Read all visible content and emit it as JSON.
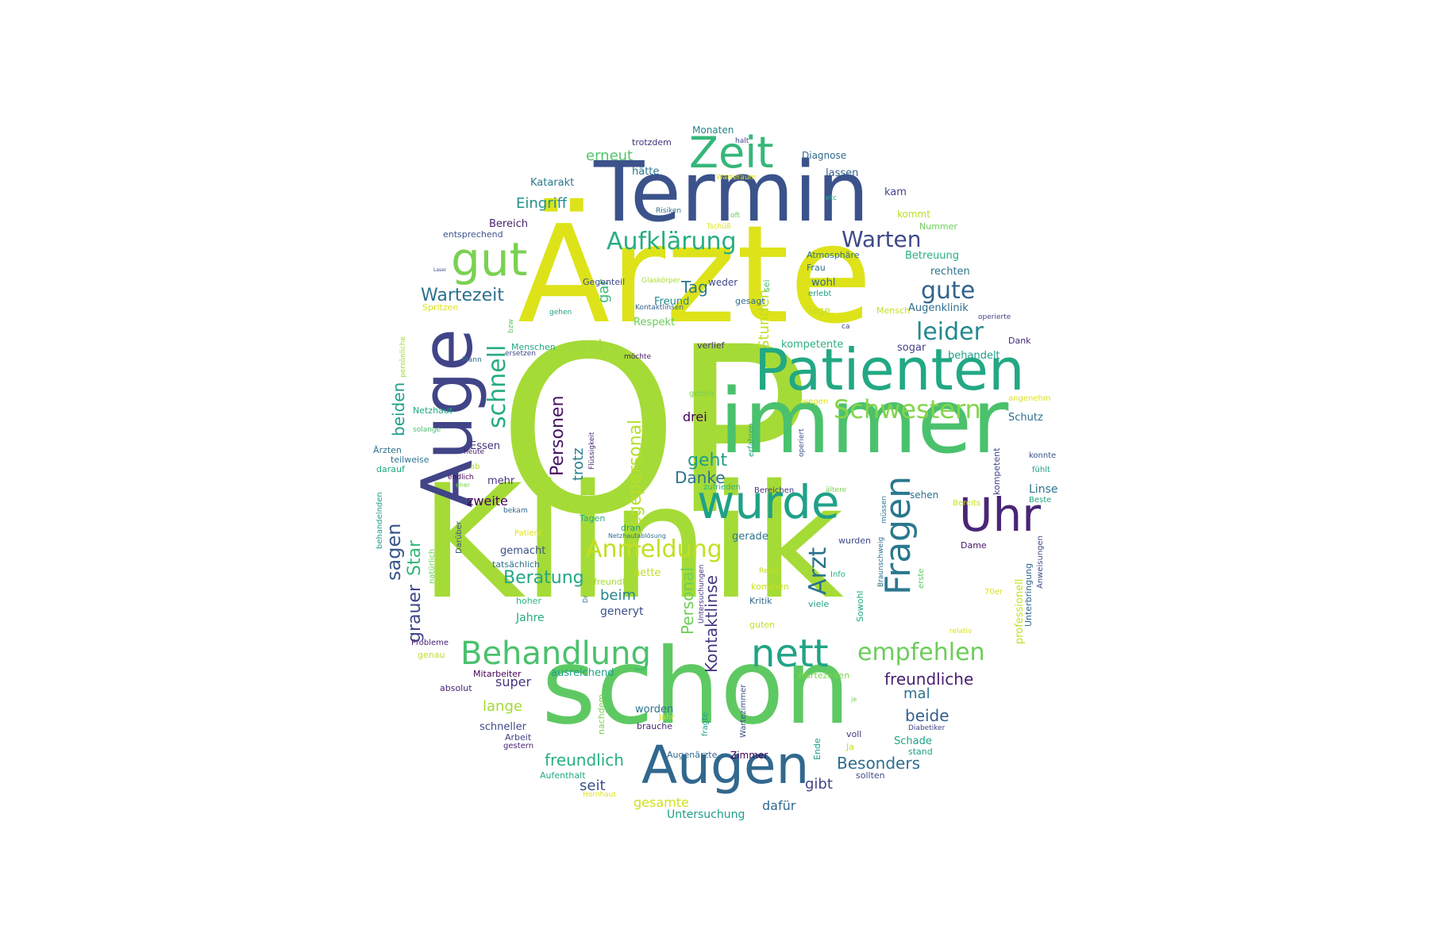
{
  "words": [
    {
      "text": "OP",
      "color": "#a5db36"
    },
    {
      "text": "Klinik",
      "color": "#a5db36"
    },
    {
      "text": "Ärzte",
      "color": "#dde318"
    },
    {
      "text": "immer",
      "color": "#4ac16d"
    },
    {
      "text": "schon",
      "color": "#5ec962"
    },
    {
      "text": "Termin",
      "color": "#3b528b"
    },
    {
      "text": "Auge",
      "color": "#414487"
    },
    {
      "text": "Patienten",
      "color": "#22a884"
    },
    {
      "text": "Augen",
      "color": "#31688e"
    },
    {
      "text": "wurde",
      "color": "#1fa187"
    },
    {
      "text": "Zeit",
      "color": "#35b779"
    },
    {
      "text": "Uhr",
      "color": "#482677"
    },
    {
      "text": "gut",
      "color": "#7ad151"
    },
    {
      "text": "nett",
      "color": "#20a486"
    },
    {
      "text": "Behandlung",
      "color": "#4ac16d"
    },
    {
      "text": "Fragen",
      "color": "#2a788e"
    },
    {
      "text": "Arzt",
      "color": "#2c728e"
    },
    {
      "text": "empfehlen",
      "color": "#6ccd5a"
    },
    {
      "text": "Schwestern",
      "color": "#84d44b"
    },
    {
      "text": "Aufklärung",
      "color": "#27ad81"
    },
    {
      "text": "Warten",
      "color": "#3e4a89"
    },
    {
      "text": "leider",
      "color": "#23898e"
    },
    {
      "text": "gute",
      "color": "#33638d"
    },
    {
      "text": "schnell",
      "color": "#25ab82"
    },
    {
      "text": "Wartezeit",
      "color": "#2d708e"
    },
    {
      "text": "Personen",
      "color": "#471365"
    },
    {
      "text": "Pflegepersonal",
      "color": "#b5de2b"
    },
    {
      "text": "Kontaktlinse",
      "color": "#453781"
    },
    {
      "text": "Personal",
      "color": "#6ece58"
    },
    {
      "text": "sagen",
      "color": "#39568c"
    },
    {
      "text": "grauer",
      "color": "#3f4788"
    },
    {
      "text": "Star",
      "color": "#35b779"
    },
    {
      "text": "beiden",
      "color": "#1f9e89"
    },
    {
      "text": "trotz",
      "color": "#26828e"
    },
    {
      "text": "Stunden",
      "color": "#c0df25"
    },
    {
      "text": "gar",
      "color": "#3aba76"
    },
    {
      "text": "geht",
      "color": "#1e9c89"
    },
    {
      "text": "Danke",
      "color": "#2c738e"
    },
    {
      "text": "Anmeldung",
      "color": "#c2df23"
    },
    {
      "text": "Beratung",
      "color": "#22a785"
    },
    {
      "text": "beide",
      "color": "#34618d"
    },
    {
      "text": "freundliche",
      "color": "#481f70"
    },
    {
      "text": "freundlich",
      "color": "#29af7f"
    },
    {
      "text": "Besonders",
      "color": "#2e6e8e"
    },
    {
      "text": "zwei",
      "color": "#9bd93c"
    },
    {
      "text": "erneut",
      "color": "#52c569"
    },
    {
      "text": "Eingriff",
      "color": "#21918c"
    },
    {
      "text": "Tag",
      "color": "#2a788e"
    },
    {
      "text": "mal",
      "color": "#2c738e"
    },
    {
      "text": "beim",
      "color": "#24868e"
    },
    {
      "text": "lange",
      "color": "#a2da37"
    },
    {
      "text": "super",
      "color": "#46337e"
    },
    {
      "text": "seit",
      "color": "#3b528b"
    },
    {
      "text": "gibt",
      "color": "#414487"
    },
    {
      "text": "zweite",
      "color": "#440154"
    },
    {
      "text": "drei",
      "color": "#440154"
    },
    {
      "text": "dafür",
      "color": "#30698e"
    },
    {
      "text": "gesamte",
      "color": "#d0e11c"
    },
    {
      "text": "Untersuchung",
      "color": "#1f9e89"
    },
    {
      "text": "Katarakt",
      "color": "#2a788e"
    },
    {
      "text": "hätte",
      "color": "#2a788e"
    },
    {
      "text": "lassen",
      "color": "#34618d"
    },
    {
      "text": "Diagnose",
      "color": "#31688e"
    },
    {
      "text": "Monaten",
      "color": "#25848e"
    },
    {
      "text": "trotzdem",
      "color": "#46337e"
    },
    {
      "text": "halt",
      "color": "#404588"
    },
    {
      "text": "Warteraum",
      "color": "#dde318"
    },
    {
      "text": "kam",
      "color": "#414487"
    },
    {
      "text": "etc",
      "color": "#25ab82"
    },
    {
      "text": "kommt",
      "color": "#b8de29"
    },
    {
      "text": "Nummer",
      "color": "#6ccd5a"
    },
    {
      "text": "Risiken",
      "color": "#2c738e"
    },
    {
      "text": "Tschüß",
      "color": "#dde318"
    },
    {
      "text": "oft",
      "color": "#6ece58"
    },
    {
      "text": "Bereich",
      "color": "#481f70"
    },
    {
      "text": "entsprechend",
      "color": "#3b528b"
    },
    {
      "text": "Gegenteil",
      "color": "#3e4a89"
    },
    {
      "text": "Glaskörper",
      "color": "#a8db34"
    },
    {
      "text": "weder",
      "color": "#3f4788"
    },
    {
      "text": "Frau",
      "color": "#2e6e8e"
    },
    {
      "text": "Atmosphäre",
      "color": "#2c728e"
    },
    {
      "text": "Betreuung",
      "color": "#29af7f"
    },
    {
      "text": "rechten",
      "color": "#2c728e"
    },
    {
      "text": "Laser",
      "color": "#3e4a89"
    },
    {
      "text": "Freund",
      "color": "#238a8d"
    },
    {
      "text": "gesagt",
      "color": "#2e6e8e"
    },
    {
      "text": "wohl",
      "color": "#31688e"
    },
    {
      "text": "erlebt",
      "color": "#1fa088"
    },
    {
      "text": "Augenklinik",
      "color": "#2e6e8e"
    },
    {
      "text": "Kontaktlinsen",
      "color": "#34618d"
    },
    {
      "text": "Spritzen",
      "color": "#dde318"
    },
    {
      "text": "gehen",
      "color": "#1fa187"
    },
    {
      "text": "sei",
      "color": "#4ac16d"
    },
    {
      "text": "Tage",
      "color": "#c2df23"
    },
    {
      "text": "Mensch",
      "color": "#c2df23"
    },
    {
      "text": "operierte",
      "color": "#414487"
    },
    {
      "text": "bzw",
      "color": "#5ec962"
    },
    {
      "text": "Respekt",
      "color": "#6ccd5a"
    },
    {
      "text": "ca",
      "color": "#404588"
    },
    {
      "text": "Dank",
      "color": "#482677"
    },
    {
      "text": "persönliche",
      "color": "#9bd93c"
    },
    {
      "text": "Mann",
      "color": "#2e6e8e"
    },
    {
      "text": "Menschen",
      "color": "#22a785"
    },
    {
      "text": "verlief",
      "color": "#46337e"
    },
    {
      "text": "kompetente",
      "color": "#2db27d"
    },
    {
      "text": "sogar",
      "color": "#414487"
    },
    {
      "text": "ersetzen",
      "color": "#3e4a89"
    },
    {
      "text": "möchte",
      "color": "#481769"
    },
    {
      "text": "behandelt",
      "color": "#1fa188"
    },
    {
      "text": "angenehm",
      "color": "#dde318"
    },
    {
      "text": "Netzhaut",
      "color": "#22a884"
    },
    {
      "text": "geben",
      "color": "#7ad151"
    },
    {
      "text": "wegen",
      "color": "#dde318"
    },
    {
      "text": "Schutz",
      "color": "#2c728e"
    },
    {
      "text": "solange",
      "color": "#4ac16d"
    },
    {
      "text": "Essen",
      "color": "#46337e"
    },
    {
      "text": "Flüssigkeit",
      "color": "#482677"
    },
    {
      "text": "operiert",
      "color": "#3b528b"
    },
    {
      "text": "erfahren",
      "color": "#22a884"
    },
    {
      "text": "konnte",
      "color": "#3b528b"
    },
    {
      "text": "fühlt",
      "color": "#1f9e89"
    },
    {
      "text": "Ärzten",
      "color": "#2d708e"
    },
    {
      "text": "teilweise",
      "color": "#2c728e"
    },
    {
      "text": "heute",
      "color": "#481f70"
    },
    {
      "text": "darauf",
      "color": "#22a884"
    },
    {
      "text": "ab",
      "color": "#b8de29"
    },
    {
      "text": "endlich",
      "color": "#440154"
    },
    {
      "text": "eher",
      "color": "#7ad151"
    },
    {
      "text": "mehr",
      "color": "#46337e"
    },
    {
      "text": "kompetent",
      "color": "#3f4788"
    },
    {
      "text": "Linse",
      "color": "#2c738e"
    },
    {
      "text": "Beste",
      "color": "#20a386"
    },
    {
      "text": "Bereits",
      "color": "#c8e020"
    },
    {
      "text": "sehen",
      "color": "#2c728e"
    },
    {
      "text": "zufrieden",
      "color": "#2db27d"
    },
    {
      "text": "Bereichen",
      "color": "#453781"
    },
    {
      "text": "ältere",
      "color": "#7ad151"
    },
    {
      "text": "müssen",
      "color": "#2a788e"
    },
    {
      "text": "Braunschweig",
      "color": "#2d708e"
    },
    {
      "text": "wurden",
      "color": "#3e4a89"
    },
    {
      "text": "gerade",
      "color": "#2c728e"
    },
    {
      "text": "behandelnden",
      "color": "#1f9e89"
    },
    {
      "text": "bekam",
      "color": "#31688e"
    },
    {
      "text": "Tagen",
      "color": "#27ad81"
    },
    {
      "text": "Patient",
      "color": "#dde318"
    },
    {
      "text": "Darüber",
      "color": "#3b528b"
    },
    {
      "text": "dran",
      "color": "#1f9e89"
    },
    {
      "text": "Netzhautablösung",
      "color": "#2c728e"
    },
    {
      "text": "professionell",
      "color": "#c2df23"
    },
    {
      "text": "Unterbringung",
      "color": "#31688e"
    },
    {
      "text": "Anweisungen",
      "color": "#3e4a89"
    },
    {
      "text": "Dame",
      "color": "#471365"
    },
    {
      "text": "gemacht",
      "color": "#3b528b"
    },
    {
      "text": "tatsächlich",
      "color": "#2c728e"
    },
    {
      "text": "natürlich",
      "color": "#6ccd5a"
    },
    {
      "text": "nette",
      "color": "#c2df23"
    },
    {
      "text": "Untersuchungen",
      "color": "#46337e"
    },
    {
      "text": "unfreundlich",
      "color": "#a2da37"
    },
    {
      "text": "Regel",
      "color": "#c2df23"
    },
    {
      "text": "Info",
      "color": "#29af7f"
    },
    {
      "text": "kommen",
      "color": "#c8e020"
    },
    {
      "text": "erste",
      "color": "#5ec962"
    },
    {
      "text": "70er",
      "color": "#dde318"
    },
    {
      "text": "Dr",
      "color": "#2c728e"
    },
    {
      "text": "hoher",
      "color": "#2db27d"
    },
    {
      "text": "Kritik",
      "color": "#31688e"
    },
    {
      "text": "viele",
      "color": "#20a386"
    },
    {
      "text": "Sowohl",
      "color": "#22a884"
    },
    {
      "text": "Jahre",
      "color": "#25ab82"
    },
    {
      "text": "generyt",
      "color": "#3b528b"
    },
    {
      "text": "guten",
      "color": "#c2df23"
    },
    {
      "text": "relativ",
      "color": "#dde318"
    },
    {
      "text": "Probleme",
      "color": "#481f70"
    },
    {
      "text": "genau",
      "color": "#c2df23"
    },
    {
      "text": "Mitarbeiter",
      "color": "#440154"
    },
    {
      "text": "ausreichend",
      "color": "#1fa088"
    },
    {
      "text": "Wartezeiten",
      "color": "#7ad151"
    },
    {
      "text": "absolut",
      "color": "#482677"
    },
    {
      "text": "je",
      "color": "#6ece58"
    },
    {
      "text": "nachdem",
      "color": "#7ad151"
    },
    {
      "text": "worden",
      "color": "#2c728e"
    },
    {
      "text": "Jahr",
      "color": "#c2df23"
    },
    {
      "text": "brauche",
      "color": "#482677"
    },
    {
      "text": "fragte",
      "color": "#1fa188"
    },
    {
      "text": "Wartezimmer",
      "color": "#3b528b"
    },
    {
      "text": "schneller",
      "color": "#3e4a89"
    },
    {
      "text": "Arbeit",
      "color": "#404588"
    },
    {
      "text": "gestern",
      "color": "#481f70"
    },
    {
      "text": "Diabetiker",
      "color": "#404588"
    },
    {
      "text": "voll",
      "color": "#46337e"
    },
    {
      "text": "Ja",
      "color": "#c8e020"
    },
    {
      "text": "Ende",
      "color": "#1f9e89"
    },
    {
      "text": "Schade",
      "color": "#20a386"
    },
    {
      "text": "stand",
      "color": "#1f9e89"
    },
    {
      "text": "Augenärzte",
      "color": "#31688e"
    },
    {
      "text": "Zimmer",
      "color": "#440154"
    },
    {
      "text": "sollten",
      "color": "#3e4a89"
    },
    {
      "text": "Aufenthalt",
      "color": "#22a884"
    },
    {
      "text": "Hornhaut",
      "color": "#dde318"
    }
  ]
}
